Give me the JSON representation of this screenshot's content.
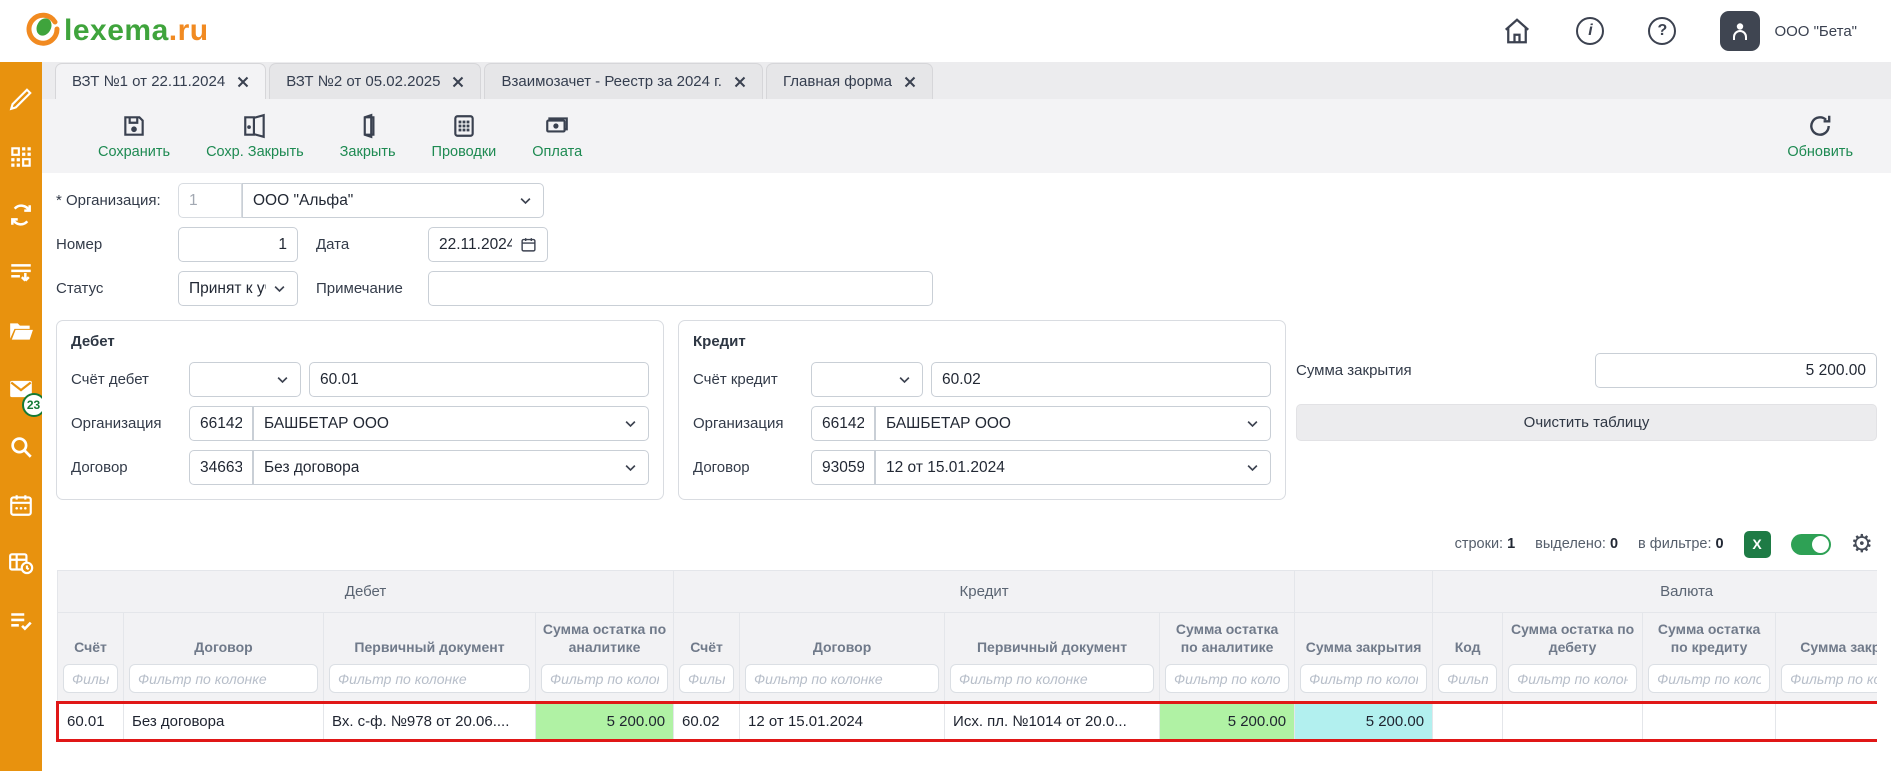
{
  "colors": {
    "sidebar_orange": "#E8920E",
    "accent_green": "#1E8A52",
    "logo_green": "#3FA43C",
    "logo_orange": "#F18A21",
    "excel_green": "#1E7B45",
    "toggle_on_green": "#2EA155",
    "selected_row_red": "#E01717",
    "cell_green": "#B0F2A4",
    "cell_cyan": "#B2F0EF"
  },
  "header": {
    "logo_text": "lexema",
    "logo_suffix": ".ru",
    "icons": [
      {
        "icon": "home-icon"
      },
      {
        "icon": "info-icon",
        "glyph": "i"
      },
      {
        "icon": "help-icon",
        "glyph": "?"
      }
    ],
    "user_org": "ООО \"Бета\""
  },
  "tabs": {
    "active": 0,
    "items": [
      {
        "label": "ВЗТ №1 от 22.11.2024"
      },
      {
        "label": "ВЗТ №2 от 05.02.2025"
      },
      {
        "label": "Взаимозачет - Реестр за 2024 г."
      },
      {
        "label": "Главная форма"
      }
    ]
  },
  "toolbar": {
    "buttons": [
      {
        "icon": "save-icon",
        "label": "Сохранить"
      },
      {
        "icon": "save-close-icon",
        "label": "Сохр. Закрыть"
      },
      {
        "icon": "close-doc-icon",
        "label": "Закрыть"
      },
      {
        "icon": "postings-icon",
        "label": "Проводки"
      },
      {
        "icon": "payment-icon",
        "label": "Оплата"
      }
    ],
    "refresh": {
      "icon": "refresh-icon",
      "label": "Обновить"
    }
  },
  "form": {
    "org": {
      "label": "* Организация:",
      "code": "1",
      "name": "ООО \"Альфа\""
    },
    "number": {
      "label": "Номер",
      "value": "1"
    },
    "date": {
      "label": "Дата",
      "value": "22.11.2024"
    },
    "status": {
      "label": "Статус",
      "value": "Принят к учету"
    },
    "note": {
      "label": "Примечание",
      "value": ""
    }
  },
  "debit": {
    "title": "Дебет",
    "account": {
      "label": "Счёт дебет",
      "combo_value": "",
      "value": "60.01"
    },
    "org": {
      "label": "Организация",
      "code": "66142",
      "name": "БАШБЕТАР ООО"
    },
    "contract": {
      "label": "Договор",
      "code": "34663",
      "name": "Без договора"
    }
  },
  "credit": {
    "title": "Кредит",
    "account": {
      "label": "Счёт кредит",
      "combo_value": "",
      "value": "60.02"
    },
    "org": {
      "label": "Организация",
      "code": "66142",
      "name": "БАШБЕТАР ООО"
    },
    "contract": {
      "label": "Договор",
      "code": "93059",
      "name": "12 от 15.01.2024"
    }
  },
  "closing": {
    "label": "Сумма закрытия",
    "value": "5 200.00",
    "clear_button": "Очистить таблицу"
  },
  "grid": {
    "stats": [
      {
        "label": "строки:",
        "value": "1"
      },
      {
        "label": "выделено:",
        "value": "0"
      },
      {
        "label": "в фильтре:",
        "value": "0"
      }
    ],
    "excel_button": "X",
    "filter_placeholder": "Фильтр по колонке",
    "groups": [
      {
        "label": "Дебет",
        "span": 4
      },
      {
        "label": "Кредит",
        "span": 4
      },
      {
        "label": "",
        "span": 1
      },
      {
        "label": "Валюта",
        "span": 4
      }
    ],
    "columns": [
      {
        "label": "Счёт",
        "align": "left"
      },
      {
        "label": "Договор",
        "align": "left"
      },
      {
        "label": "Первичный документ",
        "align": "left"
      },
      {
        "label": "Сумма остатка по аналитике",
        "align": "right"
      },
      {
        "label": "Счёт",
        "align": "left"
      },
      {
        "label": "Договор",
        "align": "left"
      },
      {
        "label": "Первичный документ",
        "align": "left"
      },
      {
        "label": "Сумма остатка по аналитике",
        "align": "right"
      },
      {
        "label": "Сумма закрытия",
        "align": "right"
      },
      {
        "label": "Код",
        "align": "left"
      },
      {
        "label": "Сумма остатка по дебету",
        "align": "right"
      },
      {
        "label": "Сумма остатка по кредиту",
        "align": "right"
      },
      {
        "label": "Сумма закрытия",
        "align": "right"
      }
    ],
    "rows": [
      {
        "selected": true,
        "cells": [
          "60.01",
          "Без договора",
          "Вх. с-ф. №978 от 20.06....",
          "5 200.00",
          "60.02",
          "12 от 15.01.2024",
          "Исх. пл. №1014 от 20.0...",
          "5 200.00",
          "5 200.00",
          "",
          "",
          "",
          ""
        ],
        "highlights": {
          "3": "green",
          "7": "green",
          "8": "cyan"
        }
      }
    ]
  },
  "sidebar": {
    "items": [
      {
        "icon": "pencil-icon"
      },
      {
        "icon": "qr-code-icon"
      },
      {
        "icon": "sync-icon"
      },
      {
        "icon": "list-download-icon"
      },
      {
        "icon": "folder-icon"
      },
      {
        "icon": "mail-icon",
        "badge": "23"
      },
      {
        "icon": "search-icon"
      },
      {
        "icon": "calendar-icon"
      },
      {
        "icon": "table-clock-icon"
      },
      {
        "icon": "list-check-icon"
      }
    ]
  }
}
